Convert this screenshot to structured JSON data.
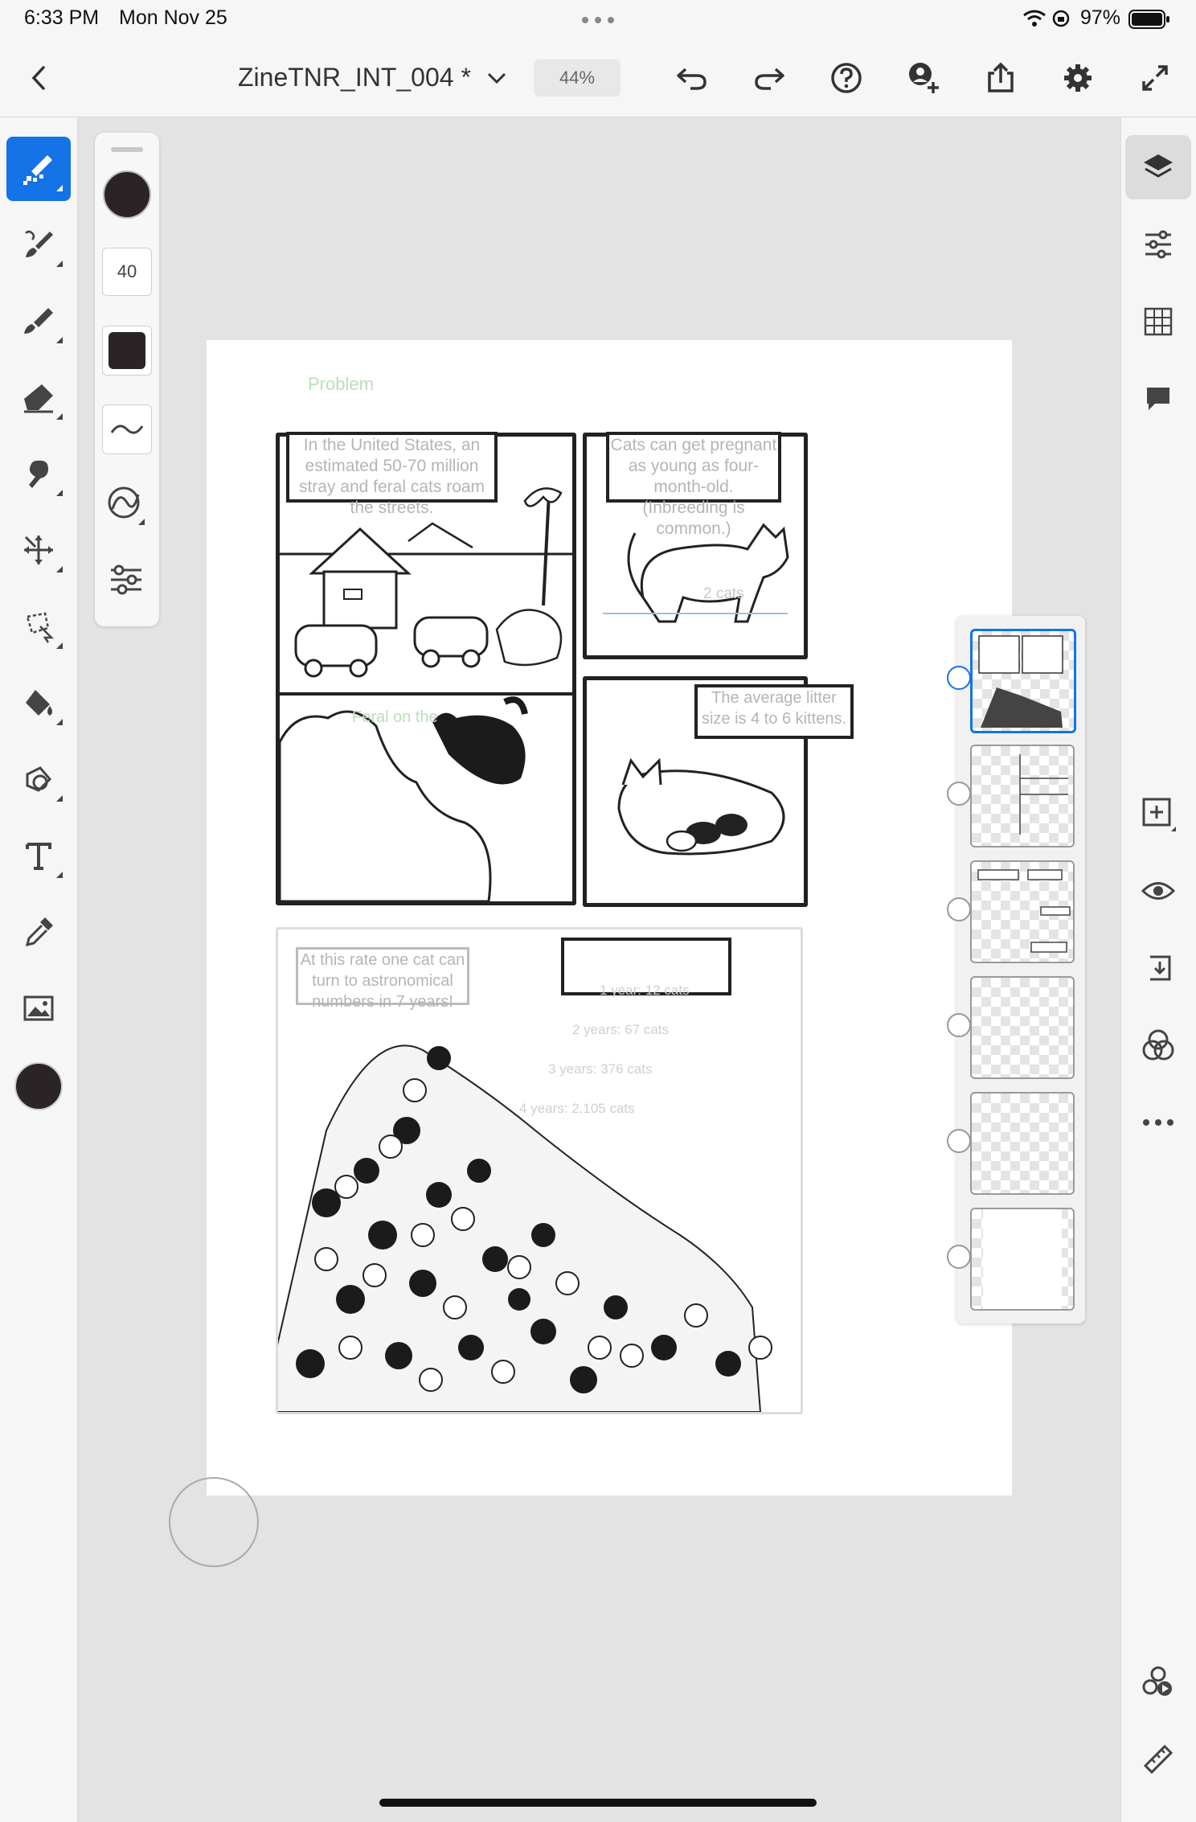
{
  "status": {
    "time": "6:33 PM",
    "date": "Mon Nov 25",
    "battery": "97%"
  },
  "document": {
    "title": "ZineTNR_INT_004 *",
    "zoom": "44%"
  },
  "toolbar": {
    "icons": [
      "back-icon",
      "chevron-down-icon",
      "undo-icon",
      "redo-icon",
      "help-icon",
      "invite-icon",
      "share-icon",
      "settings-icon",
      "fullscreen-icon"
    ]
  },
  "left_tools": [
    "pixel-brush",
    "live-brush",
    "vector-brush",
    "eraser",
    "smudge",
    "transform",
    "lasso",
    "fill",
    "liquify",
    "text",
    "eyedropper",
    "image",
    "color"
  ],
  "brush_panel": {
    "size": "40"
  },
  "colors": {
    "active": "#2b2427",
    "accent": "#1473e6"
  },
  "right_tools": [
    "layers",
    "layer-properties",
    "grid",
    "comments",
    "add-layer",
    "visibility",
    "merge",
    "blend",
    "more",
    "timelapse",
    "ruler"
  ],
  "comic": {
    "section_label": "Problem",
    "caption1": "In the United States, an estimated 50-70 million stray and feral cats roam the streets.",
    "caption2": "Cats can get pregnant as young as four-month-old. (Inbreeding is common.)",
    "caption3": "The average litter size is 4 to 6 kittens.",
    "caption4": "At this rate one cat can turn to astronomical numbers in 7 years!",
    "sketch_note1": "2 cats",
    "sketch_note2": "Feral on the",
    "counts": [
      "1 year: 12 cats",
      "2 years: 67 cats",
      "3 years: 376 cats",
      "4 years: 2,105 cats"
    ]
  }
}
